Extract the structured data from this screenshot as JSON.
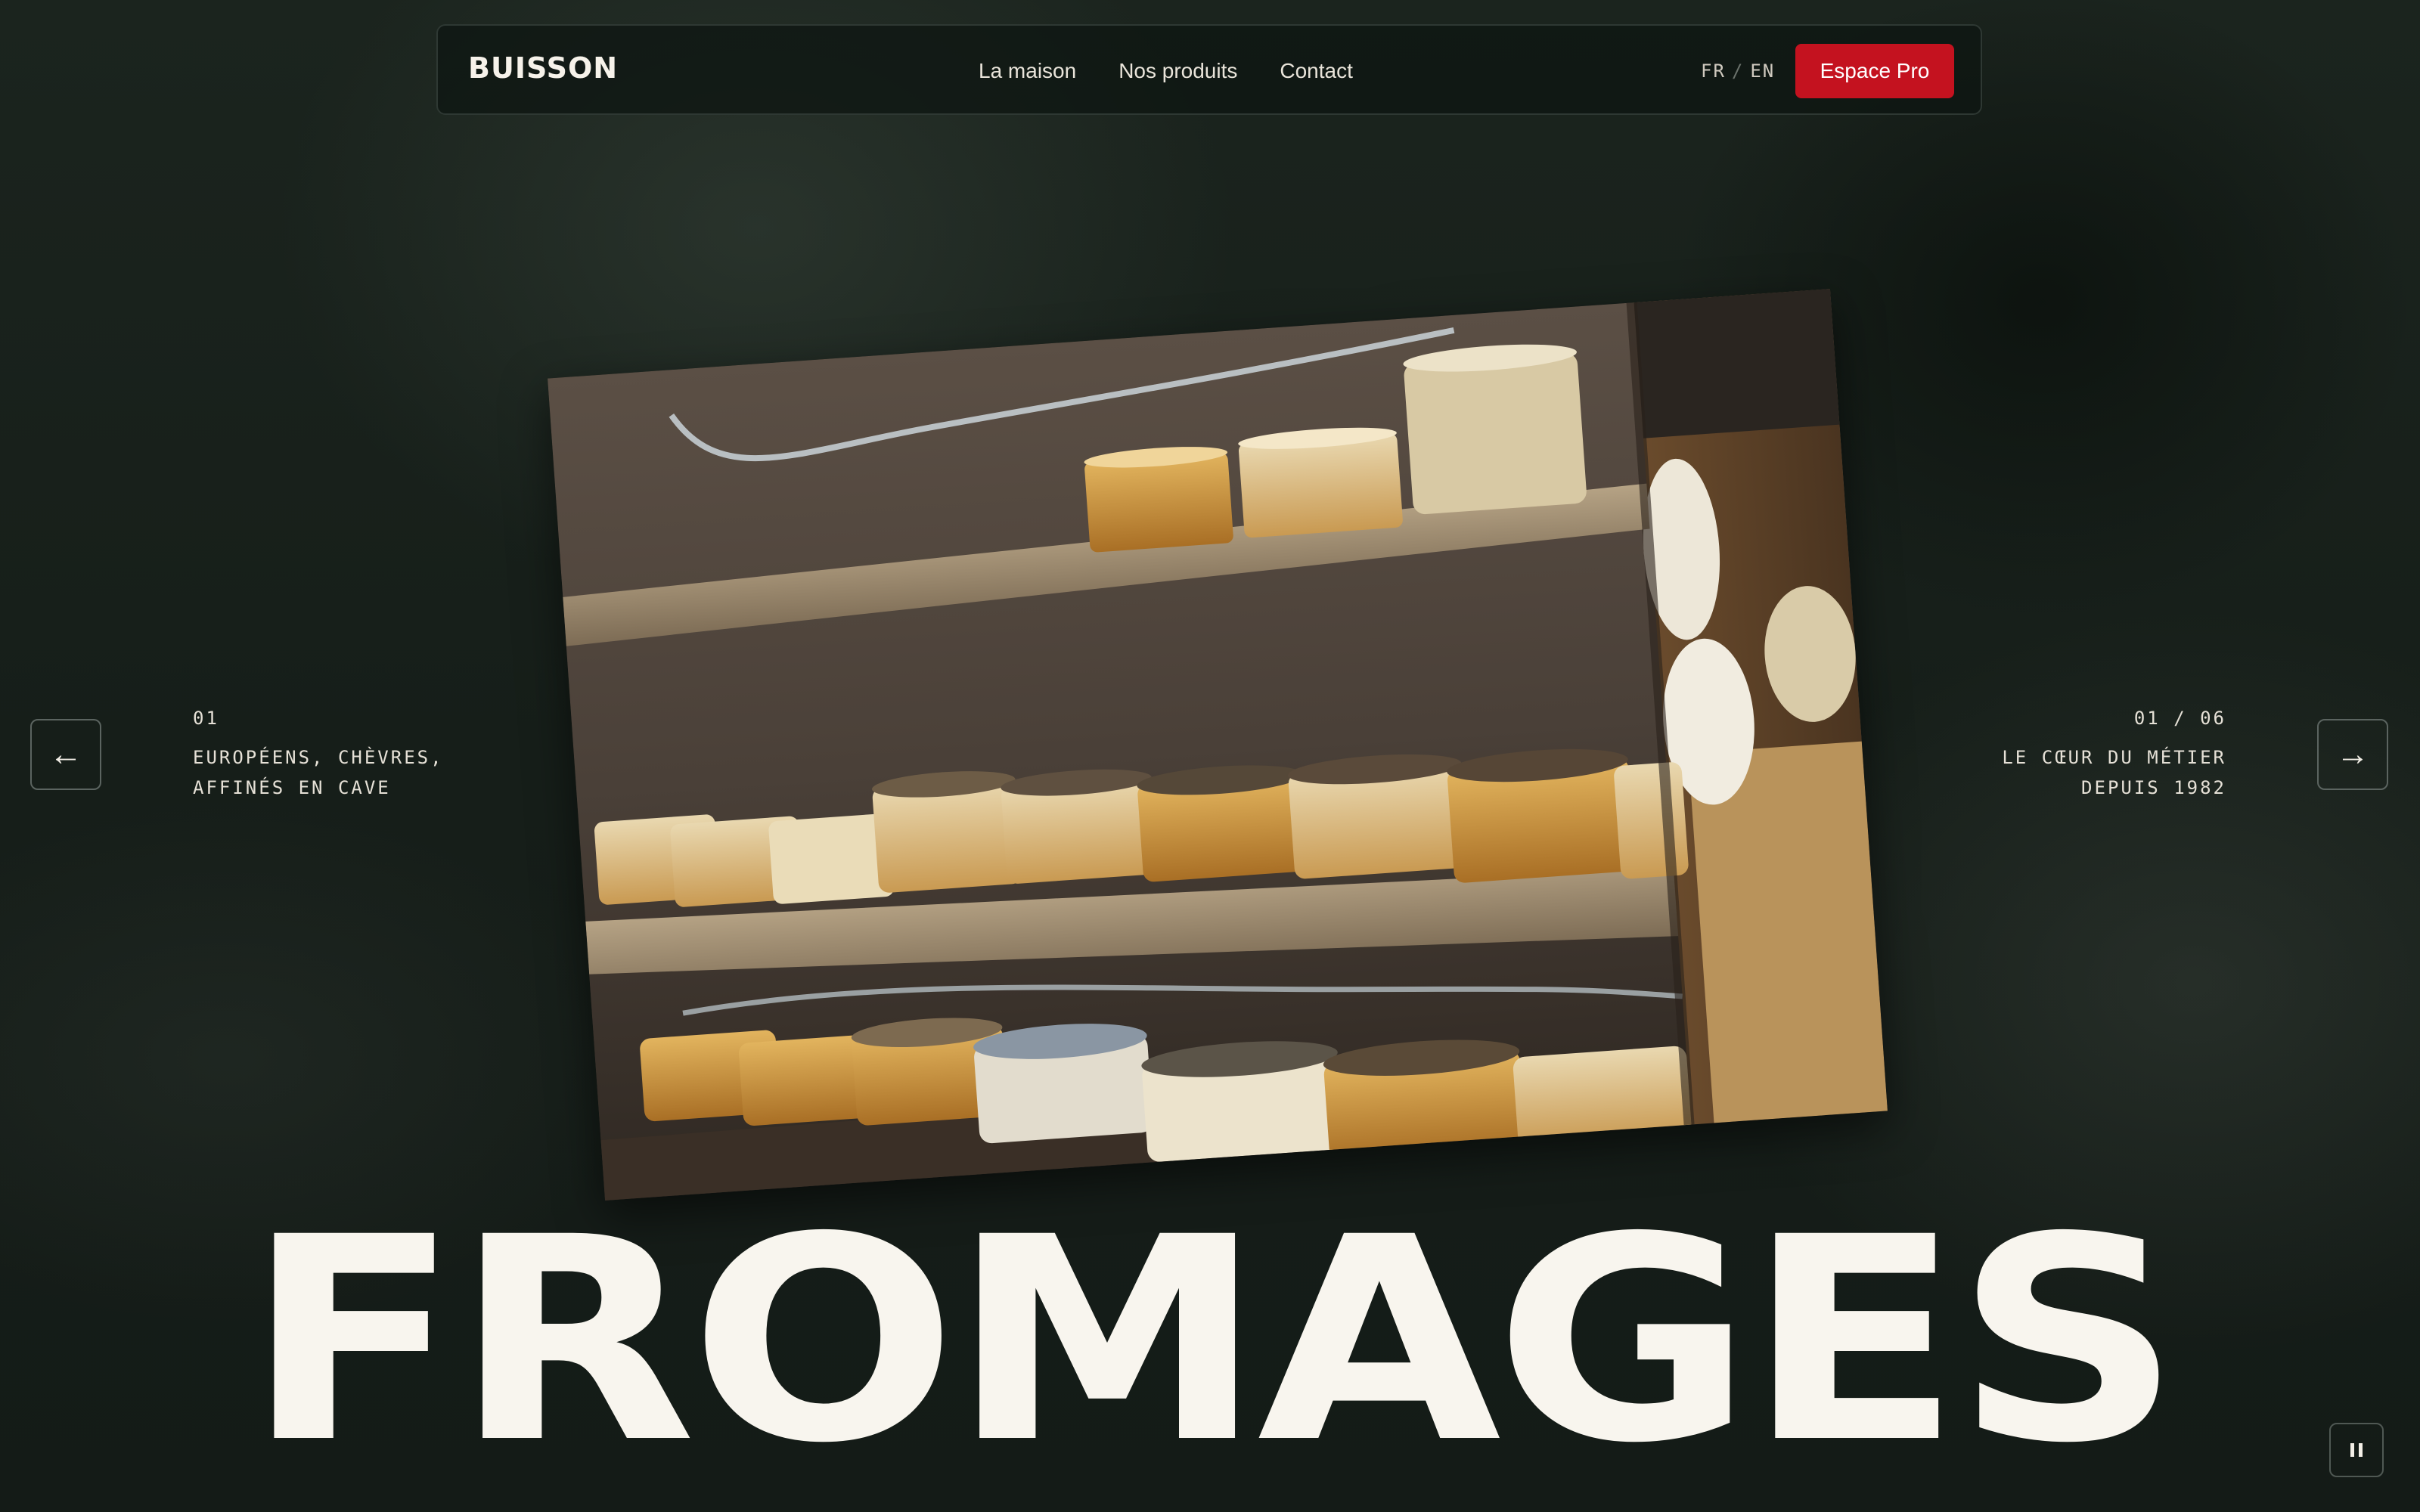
{
  "nav": {
    "logo": "BUISSON",
    "links": [
      "La maison",
      "Nos produits",
      "Contact"
    ],
    "lang_fr": "FR",
    "lang_sep": "/",
    "lang_en": "EN",
    "cta": "Espace Pro"
  },
  "slide": {
    "index": "01",
    "left_caption_line1": "EUROPÉENS, CHÈVRES,",
    "left_caption_line2": "AFFINÉS EN CAVE",
    "counter": "01 / 06",
    "right_caption_line1": "LE CŒUR DU MÉTIER",
    "right_caption_line2": "DEPUIS 1982",
    "title": "FROMAGES"
  },
  "controls": {
    "prev_icon": "arrow-left-icon",
    "prev_glyph": "←",
    "next_icon": "arrow-right-icon",
    "next_glyph": "→",
    "pause_icon": "pause-icon"
  },
  "colors": {
    "accent": "#c4121f",
    "background": "#171f1a",
    "text": "#f8f5ee"
  }
}
